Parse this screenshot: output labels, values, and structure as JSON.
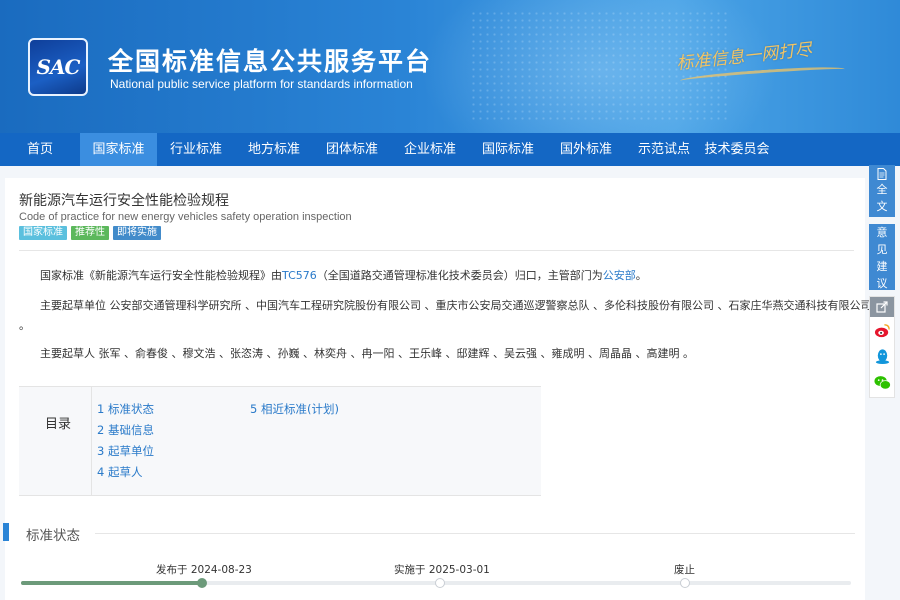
{
  "header": {
    "logo_text": "SAC",
    "title_cn": "全国标准信息公共服务平台",
    "title_en": "National public service platform  for standards information",
    "slogan": "标准信息一网打尽"
  },
  "nav": [
    "首页",
    "国家标准",
    "行业标准",
    "地方标准",
    "团体标准",
    "企业标准",
    "国际标准",
    "国外标准",
    "示范试点",
    "技术委员会"
  ],
  "nav_active_index": 1,
  "standard": {
    "title_cn": "新能源汽车运行安全性能检验规程",
    "title_en": "Code of practice for new energy vehicles safety operation inspection",
    "badges": [
      "国家标准",
      "推荐性",
      "即将实施"
    ]
  },
  "summary": {
    "p1_prefix": "国家标准《新能源汽车运行安全性能检验规程》由",
    "p1_tc": "TC576",
    "p1_mid": "（全国道路交通管理标准化技术委员会）归口，主管部门为",
    "p1_dept": "公安部",
    "p1_end": "。",
    "p2": "主要起草单位 公安部交通管理科学研究所 、中国汽车工程研究院股份有限公司 、重庆市公安局交通巡逻警察总队 、多伦科技股份有限公司 、石家庄华燕交通科技有限公司",
    "p2_cont": "。",
    "p3": "主要起草人 张军 、俞春俊 、穆文浩 、张恣涛 、孙巍 、林奕舟 、冉一阳 、王乐峰 、邸建辉 、吴云强 、雍成明 、周晶晶 、高建明 。"
  },
  "toc": {
    "label": "目录",
    "items": [
      "1  标准状态",
      "2  基础信息",
      "3  起草单位",
      "4  起草人",
      "5  相近标准(计划)"
    ]
  },
  "status_section": {
    "title": "标准状态",
    "published": "发布于 2024-08-23",
    "effective": "实施于 2025-03-01",
    "abolished": "废止"
  },
  "sidebar": {
    "fulltext": [
      "全",
      "文"
    ],
    "feedback": [
      "意",
      "见",
      "建",
      "议"
    ]
  },
  "colors": {
    "brand_blue": "#1467c4",
    "nav_active": "#3b8ee0",
    "link": "#2a7ac9",
    "timeline_done": "#6c9a7a"
  }
}
